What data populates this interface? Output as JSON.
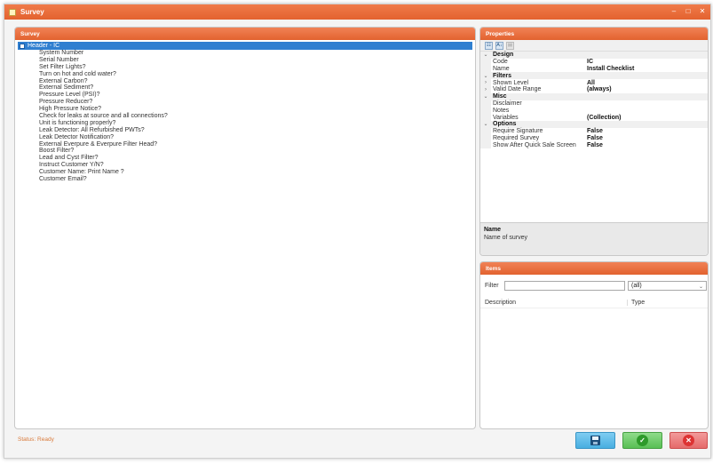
{
  "window": {
    "title": "Survey",
    "controls": [
      "‒",
      "□",
      "✕"
    ]
  },
  "survey_panel": {
    "title": "Survey",
    "header_item": "Header - IC",
    "items": [
      "System Number",
      "Serial Number",
      "Set Filter Lights?",
      "Turn on hot and cold water?",
      "External Carbon?",
      "External Sediment?",
      "Pressure Level (PSI)?",
      "Pressure Reducer?",
      "High Pressure Notice?",
      "Check for leaks at source and all connections?",
      "Unit is functioning properly?",
      "Leak Detector: All Refurbished PWTs?",
      "Leak Detector Notification?",
      "External Everpure & Everpure Filter Head?",
      "Boost Filter?",
      "Lead and Cyst Filter?",
      "Instruct Customer Y/N?",
      "Customer Name: Print Name ?",
      "Customer Email?"
    ]
  },
  "properties_panel": {
    "title": "Properties",
    "toolbar": {
      "categorized": "☷",
      "alphabetical": "A↓",
      "property_pages": "▤"
    },
    "rows": [
      {
        "type": "cat",
        "glyph": "⌄",
        "name": "Design",
        "value": ""
      },
      {
        "type": "prop",
        "glyph": "",
        "name": "Code",
        "value": "IC"
      },
      {
        "type": "prop",
        "glyph": "",
        "name": "Name",
        "value": "Install Checklist"
      },
      {
        "type": "cat",
        "glyph": "⌄",
        "name": "Filters",
        "value": ""
      },
      {
        "type": "prop",
        "glyph": "›",
        "name": "Shown Level",
        "value": "All"
      },
      {
        "type": "prop",
        "glyph": "›",
        "name": "Valid Date Range",
        "value": "(always)"
      },
      {
        "type": "cat",
        "glyph": "⌄",
        "name": "Misc",
        "value": ""
      },
      {
        "type": "prop",
        "glyph": "",
        "name": "Disclaimer",
        "value": ""
      },
      {
        "type": "prop",
        "glyph": "",
        "name": "Notes",
        "value": ""
      },
      {
        "type": "prop",
        "glyph": "",
        "name": "Variables",
        "value": "(Collection)"
      },
      {
        "type": "cat",
        "glyph": "⌄",
        "name": "Options",
        "value": ""
      },
      {
        "type": "prop",
        "glyph": "",
        "name": "Require Signature",
        "value": "False"
      },
      {
        "type": "prop",
        "glyph": "",
        "name": "Required Survey",
        "value": "False"
      },
      {
        "type": "prop",
        "glyph": "",
        "name": "Show After Quick Sale Screen",
        "value": "False"
      }
    ],
    "description": {
      "title": "Name",
      "text": "Name of survey"
    }
  },
  "items_panel": {
    "title": "Items",
    "filter_label": "Filter",
    "filter_value": "",
    "select_value": "(all)",
    "columns": [
      "Description",
      "Type"
    ]
  },
  "status": "Status: Ready",
  "buttons": {
    "save_icon": "floppy-disk-icon",
    "ok_glyph": "✓",
    "cancel_glyph": "✕"
  },
  "colors": {
    "accent": "#e66a37",
    "selection": "#2f7fd0",
    "status_text": "#d97a3a"
  }
}
